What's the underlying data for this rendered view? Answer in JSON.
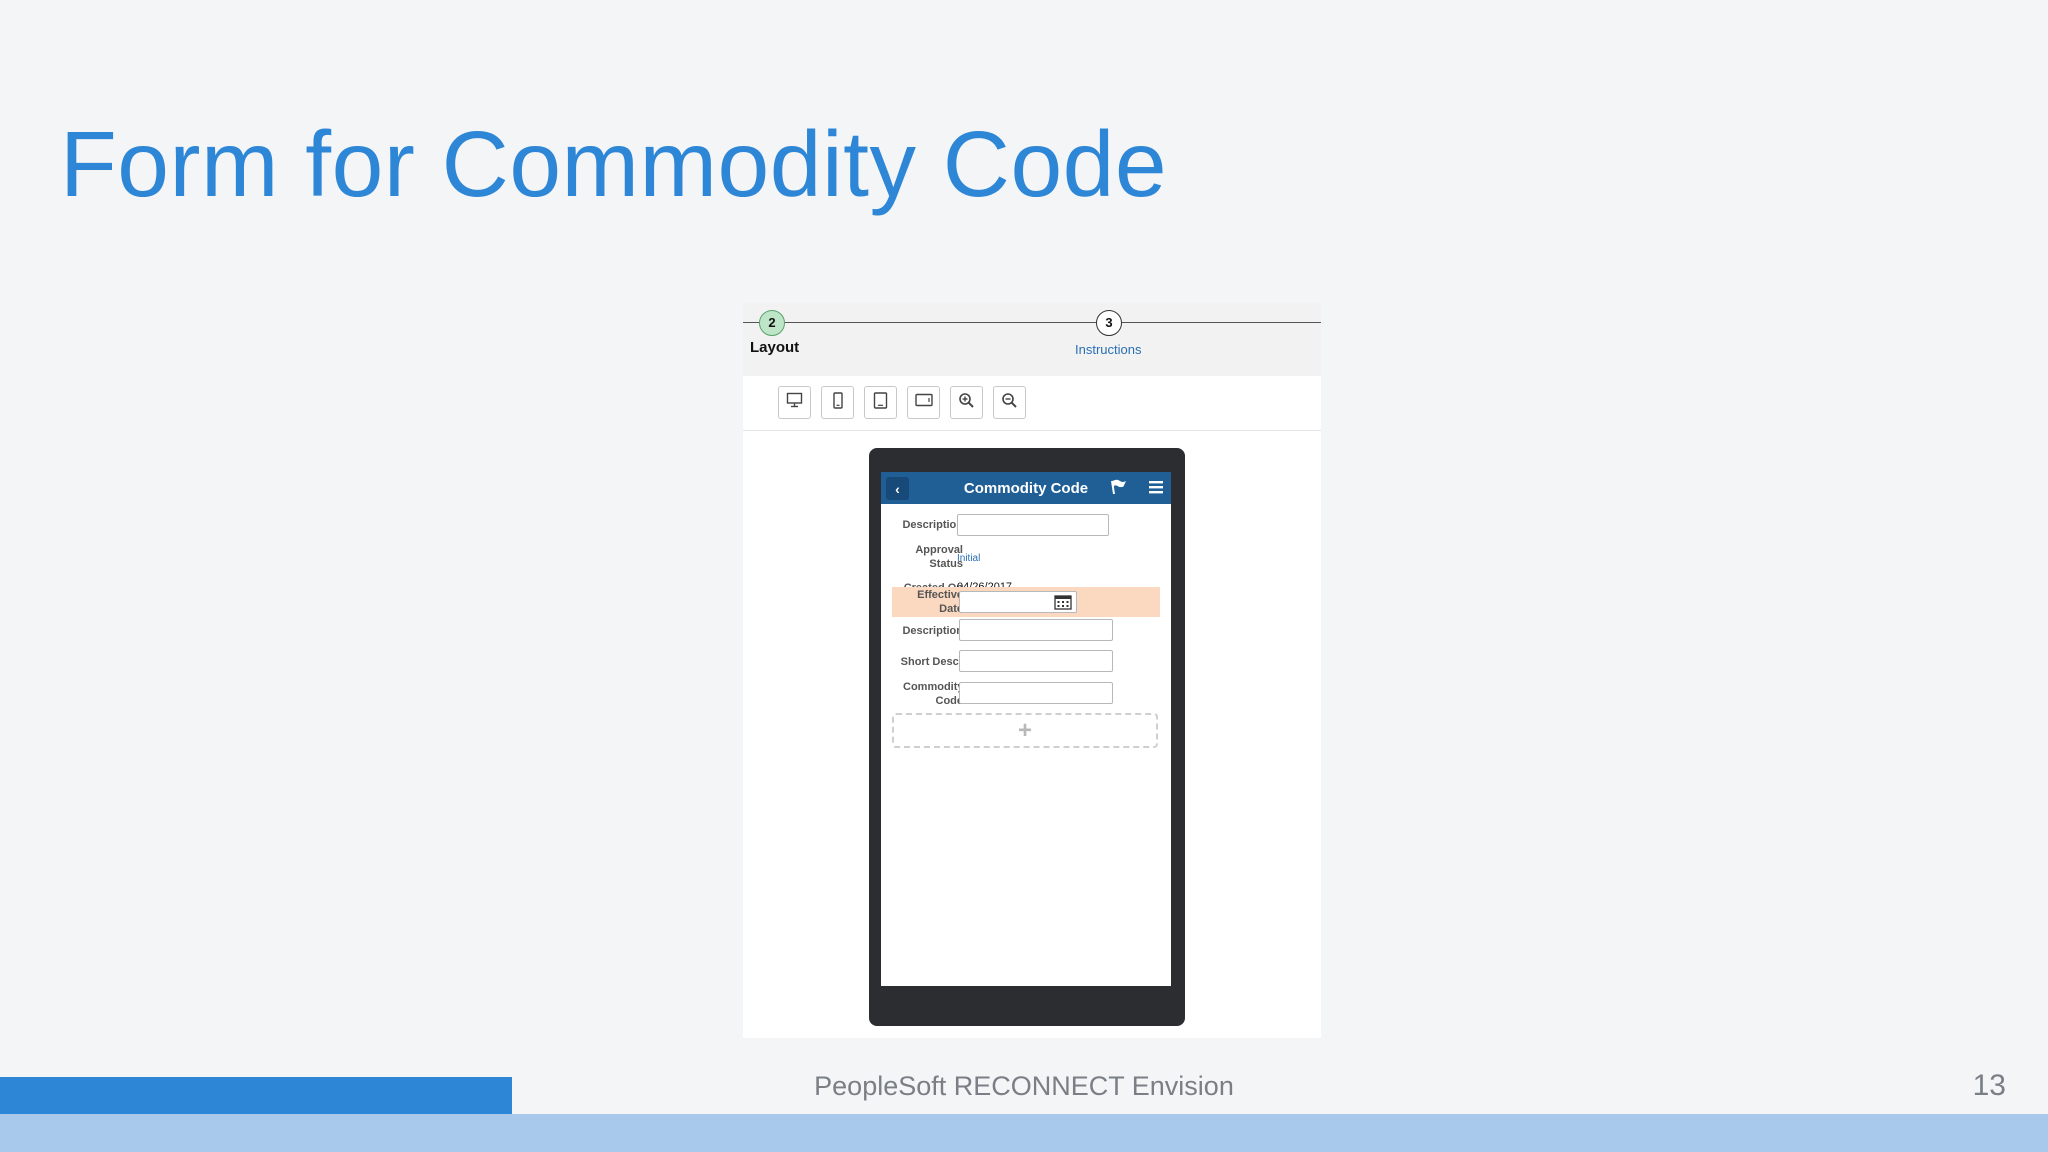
{
  "slide": {
    "title": "Form for Commodity Code",
    "footer_text": "PeopleSoft RECONNECT Envision",
    "page_number": "13"
  },
  "wizard": {
    "steps": [
      {
        "number": "2",
        "label": "Layout",
        "state": "current"
      },
      {
        "number": "3",
        "label": "Instructions",
        "state": "next"
      }
    ]
  },
  "toolbar": {
    "buttons": [
      "desktop-icon",
      "phone-icon",
      "tablet-portrait-icon",
      "tablet-landscape-icon",
      "zoom-in-icon",
      "zoom-out-icon"
    ]
  },
  "device": {
    "header": {
      "title": "Commodity Code",
      "back_label": "‹"
    },
    "fields": [
      {
        "label": "Description",
        "value": ""
      },
      {
        "label": "Approval Status",
        "value": "Initial"
      },
      {
        "label": "Created On",
        "value": "04/26/2017"
      },
      {
        "label": "Effective Date",
        "value": "",
        "highlighted": true
      },
      {
        "label": "Description",
        "value": ""
      },
      {
        "label": "Short Descr",
        "value": ""
      },
      {
        "label": "Commodity Code",
        "value": ""
      }
    ],
    "add_label": "+"
  },
  "colors": {
    "title": "#2e86d6",
    "header": "#1f5f96",
    "highlight": "#fbd9c0",
    "footer_accent": "#2e86d6",
    "footer_band": "#a9c9ec"
  }
}
